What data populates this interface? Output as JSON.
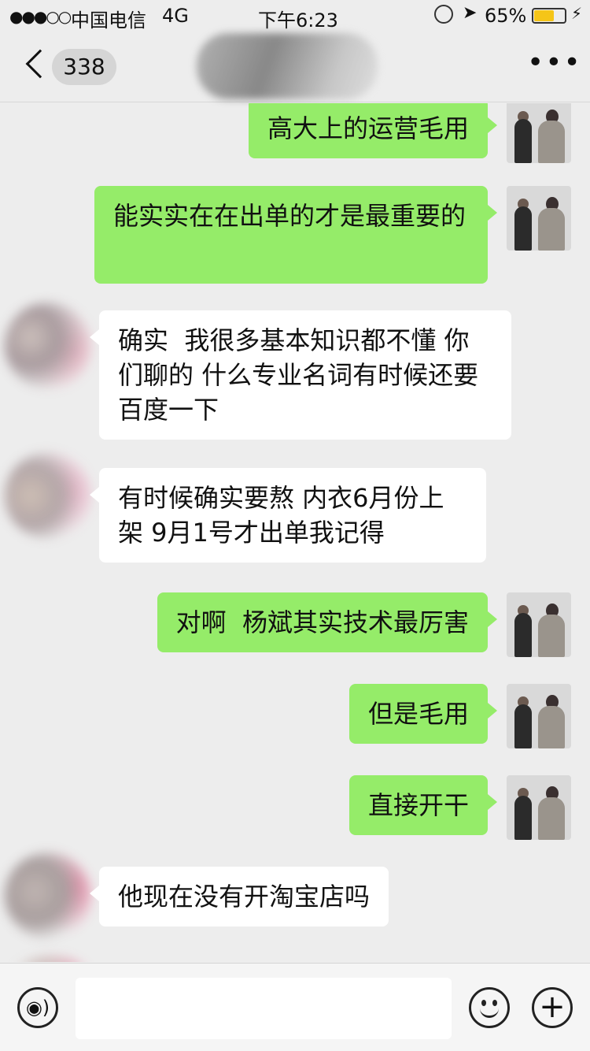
{
  "status_bar": {
    "signal": "●●●○○",
    "carrier": "中国电信",
    "network": "4G",
    "time": "下午6:23",
    "battery_percent": "65%",
    "battery_level": 0.65,
    "location_icon": "location-arrow-icon",
    "charge_icon": "charging-bolt-icon"
  },
  "nav": {
    "back_icon": "chevron-left-icon",
    "unread_count": "338",
    "more_icon": "ellipsis-icon",
    "more_label": "•••"
  },
  "messages": [
    {
      "side": "mine",
      "text": "高大上的运营毛用"
    },
    {
      "side": "mine",
      "text": "能实实在在出单的才是最重要的"
    },
    {
      "side": "theirs",
      "text": "确实  我很多基本知识都不懂 你们聊的 什么专业名词有时候还要百度一下"
    },
    {
      "side": "theirs",
      "text": "有时候确实要熬 内衣6月份上架 9月1号才出单我记得"
    },
    {
      "side": "mine",
      "text": "对啊  杨斌其实技术最厉害"
    },
    {
      "side": "mine",
      "text": "但是毛用"
    },
    {
      "side": "mine",
      "text": "直接开干"
    },
    {
      "side": "theirs",
      "text": "他现在没有开淘宝店吗"
    }
  ],
  "input_bar": {
    "voice_icon": "voice-icon",
    "voice_label": "◉)",
    "text_value": "",
    "emoji_icon": "emoji-icon",
    "plus_icon": "plus-icon",
    "plus_label": "+"
  },
  "colors": {
    "mine_bubble": "#95ec69",
    "theirs_bubble": "#ffffff",
    "background": "#ededed",
    "battery": "#f5c518"
  }
}
